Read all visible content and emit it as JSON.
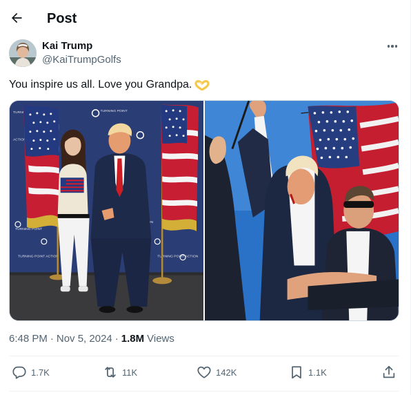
{
  "header": {
    "title": "Post"
  },
  "author": {
    "name": "Kai Trump",
    "handle": "@KaiTrumpGolfs"
  },
  "tweet": {
    "text": "You inspire us all. Love you Grandpa."
  },
  "meta": {
    "time": "6:48 PM",
    "sep": "·",
    "date": "Nov 5, 2024",
    "views_count": "1.8M",
    "views_label": "Views"
  },
  "stats": {
    "replies": "1.7K",
    "reposts": "11K",
    "likes": "142K",
    "bookmarks": "1.1K"
  },
  "photos": {
    "left_banner_text": "TURNING POINT ACTION",
    "left_logo_text": "TURNING POINT"
  },
  "colors": {
    "accent": "#1d9bf0",
    "muted": "#536471",
    "text": "#0f1419",
    "border": "#cfd9de"
  },
  "icons": [
    "back-arrow-icon",
    "more-icon",
    "heart-hands-emoji",
    "reply-icon",
    "repost-icon",
    "like-icon",
    "bookmark-icon",
    "share-icon"
  ]
}
